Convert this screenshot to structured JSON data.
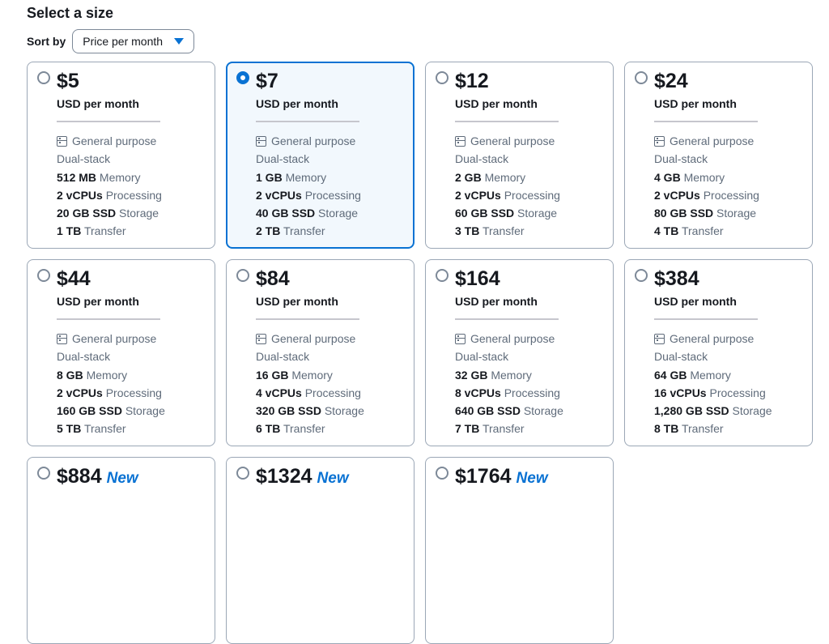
{
  "heading": "Select a size",
  "sort": {
    "label": "Sort by",
    "value": "Price per month"
  },
  "plans": [
    {
      "price": "$5",
      "per": "USD per month",
      "type": "General purpose",
      "stack": "Dual-stack",
      "memory_value": "512 MB",
      "memory_label": "Memory",
      "cpu_value": "2 vCPUs",
      "cpu_label": "Processing",
      "storage_value": "20 GB SSD",
      "storage_label": "Storage",
      "transfer_value": "1 TB",
      "transfer_label": "Transfer",
      "new_label": "",
      "selected": false
    },
    {
      "price": "$7",
      "per": "USD per month",
      "type": "General purpose",
      "stack": "Dual-stack",
      "memory_value": "1 GB",
      "memory_label": "Memory",
      "cpu_value": "2 vCPUs",
      "cpu_label": "Processing",
      "storage_value": "40 GB SSD",
      "storage_label": "Storage",
      "transfer_value": "2 TB",
      "transfer_label": "Transfer",
      "new_label": "",
      "selected": true
    },
    {
      "price": "$12",
      "per": "USD per month",
      "type": "General purpose",
      "stack": "Dual-stack",
      "memory_value": "2 GB",
      "memory_label": "Memory",
      "cpu_value": "2 vCPUs",
      "cpu_label": "Processing",
      "storage_value": "60 GB SSD",
      "storage_label": "Storage",
      "transfer_value": "3 TB",
      "transfer_label": "Transfer",
      "new_label": "",
      "selected": false
    },
    {
      "price": "$24",
      "per": "USD per month",
      "type": "General purpose",
      "stack": "Dual-stack",
      "memory_value": "4 GB",
      "memory_label": "Memory",
      "cpu_value": "2 vCPUs",
      "cpu_label": "Processing",
      "storage_value": "80 GB SSD",
      "storage_label": "Storage",
      "transfer_value": "4 TB",
      "transfer_label": "Transfer",
      "new_label": "",
      "selected": false
    },
    {
      "price": "$44",
      "per": "USD per month",
      "type": "General purpose",
      "stack": "Dual-stack",
      "memory_value": "8 GB",
      "memory_label": "Memory",
      "cpu_value": "2 vCPUs",
      "cpu_label": "Processing",
      "storage_value": "160 GB SSD",
      "storage_label": "Storage",
      "transfer_value": "5 TB",
      "transfer_label": "Transfer",
      "new_label": "",
      "selected": false
    },
    {
      "price": "$84",
      "per": "USD per month",
      "type": "General purpose",
      "stack": "Dual-stack",
      "memory_value": "16 GB",
      "memory_label": "Memory",
      "cpu_value": "4 vCPUs",
      "cpu_label": "Processing",
      "storage_value": "320 GB SSD",
      "storage_label": "Storage",
      "transfer_value": "6 TB",
      "transfer_label": "Transfer",
      "new_label": "",
      "selected": false
    },
    {
      "price": "$164",
      "per": "USD per month",
      "type": "General purpose",
      "stack": "Dual-stack",
      "memory_value": "32 GB",
      "memory_label": "Memory",
      "cpu_value": "8 vCPUs",
      "cpu_label": "Processing",
      "storage_value": "640 GB SSD",
      "storage_label": "Storage",
      "transfer_value": "7 TB",
      "transfer_label": "Transfer",
      "new_label": "",
      "selected": false
    },
    {
      "price": "$384",
      "per": "USD per month",
      "type": "General purpose",
      "stack": "Dual-stack",
      "memory_value": "64 GB",
      "memory_label": "Memory",
      "cpu_value": "16 vCPUs",
      "cpu_label": "Processing",
      "storage_value": "1,280 GB SSD",
      "storage_label": "Storage",
      "transfer_value": "8 TB",
      "transfer_label": "Transfer",
      "new_label": "",
      "selected": false
    },
    {
      "price": "$884",
      "new_label": "New",
      "selected": false
    },
    {
      "price": "$1324",
      "new_label": "New",
      "selected": false
    },
    {
      "price": "$1764",
      "new_label": "New",
      "selected": false
    }
  ],
  "colors": {
    "accent": "#0972d3",
    "selected_bg": "#f2f8fd",
    "border": "#9ba7b6",
    "muted_text": "#5f6b7a"
  }
}
